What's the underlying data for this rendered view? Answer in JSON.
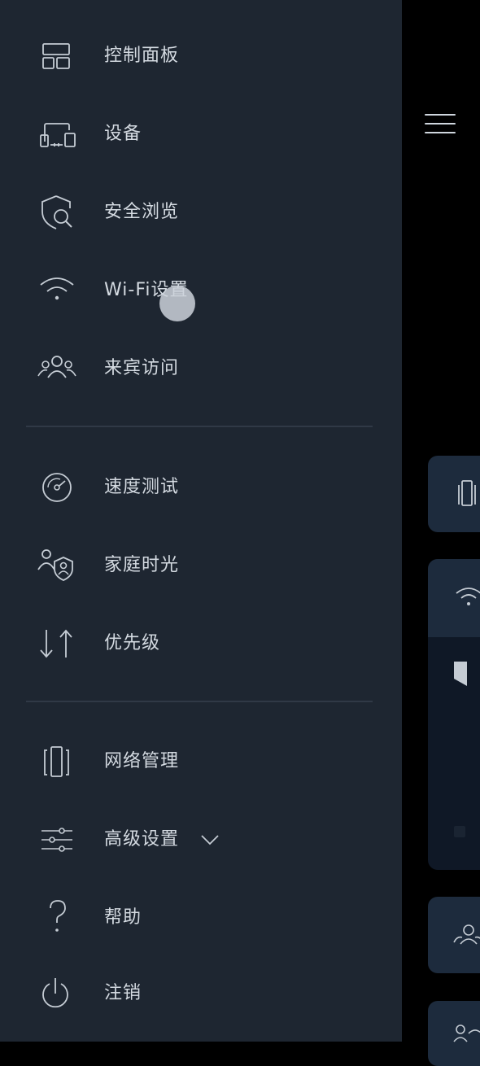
{
  "menu": {
    "items": [
      {
        "label": "控制面板",
        "icon": "dashboard-icon"
      },
      {
        "label": "设备",
        "icon": "devices-icon"
      },
      {
        "label": "安全浏览",
        "icon": "shield-search-icon"
      },
      {
        "label": "Wi-Fi设置",
        "icon": "wifi-icon"
      },
      {
        "label": "来宾访问",
        "icon": "guest-access-icon"
      },
      {
        "label": "速度测试",
        "icon": "speedometer-icon"
      },
      {
        "label": "家庭时光",
        "icon": "parental-control-icon"
      },
      {
        "label": "优先级",
        "icon": "priority-arrows-icon"
      },
      {
        "label": "网络管理",
        "icon": "network-node-icon"
      },
      {
        "label": "高级设置",
        "icon": "sliders-icon"
      },
      {
        "label": "帮助",
        "icon": "help-icon"
      },
      {
        "label": "注销",
        "icon": "power-icon"
      }
    ]
  },
  "colors": {
    "drawer_bg": "#1e2631",
    "label": "#d4dae1",
    "icon_stroke": "#c5ccd4",
    "divider": "#303946",
    "card_bg": "#1d2b3d"
  }
}
